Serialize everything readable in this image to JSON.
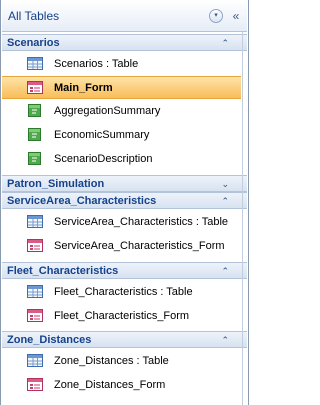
{
  "pane": {
    "title": "All Tables",
    "menu_glyph": "▾",
    "collapse_glyph": "«"
  },
  "groups": [
    {
      "label": "Scenarios",
      "chevron": "⌃",
      "items": [
        {
          "label": "Scenarios : Table",
          "icon": "table-icon"
        },
        {
          "label": "Main_Form",
          "icon": "form-icon",
          "selected": true
        },
        {
          "label": "AggregationSummary",
          "icon": "query-icon"
        },
        {
          "label": "EconomicSummary",
          "icon": "query-icon"
        },
        {
          "label": "ScenarioDescription",
          "icon": "query-icon"
        }
      ]
    },
    {
      "label": "Patron_Simulation",
      "chevron": "⌄",
      "items": []
    },
    {
      "label": "ServiceArea_Characteristics",
      "chevron": "⌃",
      "items": [
        {
          "label": "ServiceArea_Characteristics : Table",
          "icon": "table-icon"
        },
        {
          "label": "ServiceArea_Characteristics_Form",
          "icon": "form-icon"
        }
      ]
    },
    {
      "label": "Fleet_Characteristics",
      "chevron": "⌃",
      "items": [
        {
          "label": "Fleet_Characteristics : Table",
          "icon": "table-icon"
        },
        {
          "label": "Fleet_Characteristics_Form",
          "icon": "form-icon"
        }
      ]
    },
    {
      "label": "Zone_Distances",
      "chevron": "⌃",
      "items": [
        {
          "label": "Zone_Distances : Table",
          "icon": "table-icon"
        },
        {
          "label": "Zone_Distances_Form",
          "icon": "form-icon"
        }
      ]
    }
  ]
}
